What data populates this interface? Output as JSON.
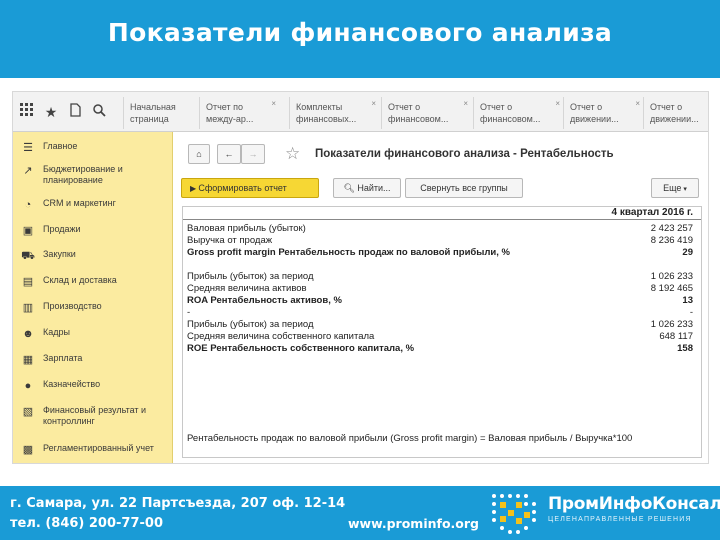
{
  "slide": {
    "title": "Показатели финансового анализа"
  },
  "topbar": {
    "tabs": [
      {
        "label": "Начальная страница",
        "closable": false
      },
      {
        "label": "Отчет по между-ар...",
        "closable": true
      },
      {
        "label": "Комплекты финансовых...",
        "closable": true
      },
      {
        "label": "Отчет о финансовом...",
        "closable": true
      },
      {
        "label": "Отчет о финансовом...",
        "closable": true
      },
      {
        "label": "Отчет о движении...",
        "closable": true
      },
      {
        "label": "Отчет о движении...",
        "closable": false
      }
    ],
    "close_glyph": "×"
  },
  "sidebar": {
    "items": [
      {
        "label": "Главное",
        "icon": "list-icon"
      },
      {
        "label": "Бюджетирование и планирование",
        "icon": "chart-trend-icon"
      },
      {
        "label": "CRM и маркетинг",
        "icon": "pie-chart-icon"
      },
      {
        "label": "Продажи",
        "icon": "bag-icon"
      },
      {
        "label": "Закупки",
        "icon": "cart-icon"
      },
      {
        "label": "Склад и доставка",
        "icon": "warehouse-icon"
      },
      {
        "label": "Производство",
        "icon": "factory-icon"
      },
      {
        "label": "Кадры",
        "icon": "people-icon"
      },
      {
        "label": "Зарплата",
        "icon": "calculator-icon"
      },
      {
        "label": "Казначейство",
        "icon": "coins-icon"
      },
      {
        "label": "Финансовый результат и контроллинг",
        "icon": "finance-icon"
      },
      {
        "label": "Регламентированный учет",
        "icon": "ledger-icon"
      }
    ]
  },
  "form": {
    "title": "Показатели финансового анализа - Рентабельность",
    "generate_label": "Сформировать отчет",
    "find_label": "Найти...",
    "collapse_label": "Свернуть все группы",
    "more_label": "Еще"
  },
  "report": {
    "period": "4 квартал 2016 г.",
    "rows": [
      {
        "name": "Валовая прибыль (убыток)",
        "value": "2 423 257",
        "bold": false
      },
      {
        "name": "Выручка от продаж",
        "value": "8 236 419",
        "bold": false
      },
      {
        "name": "Gross profit margin Рентабельность продаж по валовой прибыли, %",
        "value": "29",
        "bold": true
      },
      {
        "name": "",
        "value": "",
        "bold": false
      },
      {
        "name": "Прибыль (убыток) за период",
        "value": "1 026 233",
        "bold": false
      },
      {
        "name": "Средняя величина активов",
        "value": "8 192 465",
        "bold": false
      },
      {
        "name": "ROA Рентабельность активов, %",
        "value": "13",
        "bold": true
      },
      {
        "name": "-",
        "value": "-",
        "bold": false
      },
      {
        "name": "Прибыль (убыток) за период",
        "value": "1 026 233",
        "bold": false
      },
      {
        "name": "Средняя величина собственного капитала",
        "value": "648 117",
        "bold": false
      },
      {
        "name": "ROE Рентабельность собственного капитала, %",
        "value": "158",
        "bold": true
      }
    ],
    "formula": "Рентабельность продаж по валовой прибыли (Gross profit margin) = Валовая прибыль / Выручка*100"
  },
  "footer": {
    "address": "г. Самара, ул. 22 Партсъезда, 207 оф. 12-14",
    "phone": "тел. (846) 200-77-00",
    "website": "www.prominfo.org",
    "brand_name": "ПромИнфоКонсалт",
    "brand_tagline": "ЦЕЛЕНАПРАВЛЕННЫЕ РЕШЕНИЯ"
  },
  "colors": {
    "brand_blue": "#1a9bd6",
    "sidebar_yellow": "#fbeba0",
    "generate_button": "#f6d734"
  }
}
